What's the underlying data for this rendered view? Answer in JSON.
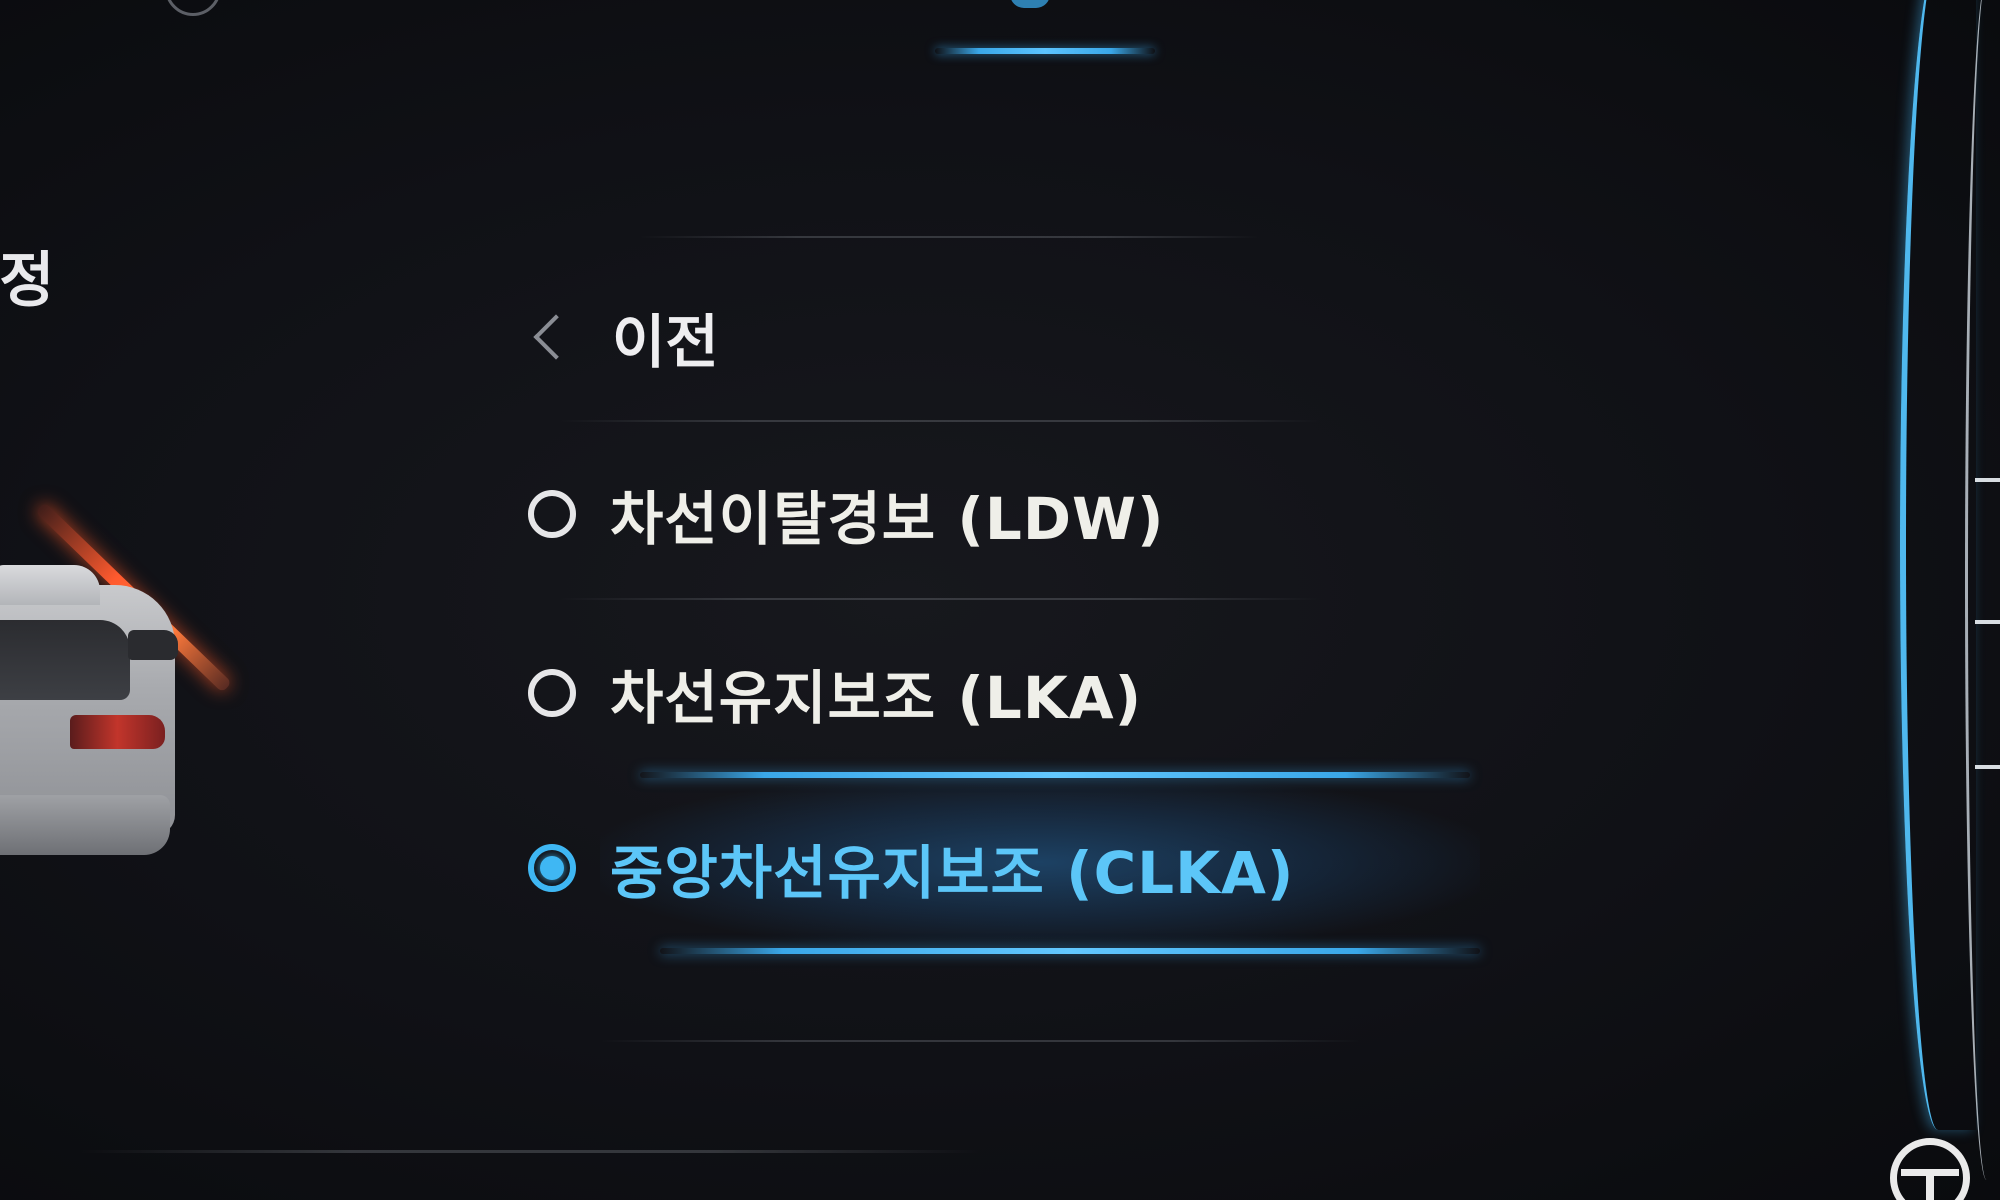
{
  "header": {
    "active_tab_icon": "car-settings-icon"
  },
  "page": {
    "title": "설정"
  },
  "menu": {
    "back": {
      "icon": "chevron-left-icon",
      "label": "이전"
    },
    "options": [
      {
        "label": "차선이탈경보 (LDW)",
        "selected": false
      },
      {
        "label": "차선유지보조 (LKA)",
        "selected": false
      },
      {
        "label": "중앙차선유지보조 (CLKA)",
        "selected": true
      }
    ]
  },
  "status": {
    "icon": "steering-wheel-icon"
  },
  "colors": {
    "background": "#0d0e12",
    "accent": "#3fb7f3",
    "text": "#efefe9",
    "warning": "#ff5a2e"
  }
}
